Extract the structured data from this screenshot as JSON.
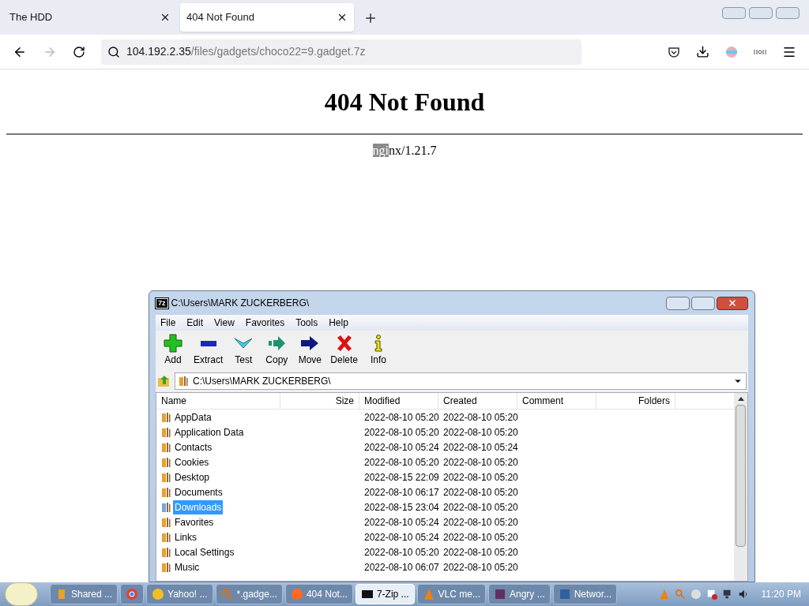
{
  "browser": {
    "tabs": [
      {
        "label": "The HDD",
        "selected": false
      },
      {
        "label": "404 Not Found",
        "selected": true
      }
    ],
    "address": {
      "host": "104.192.2.35",
      "path": "/files/gadgets/choco22=9.gadget.7z"
    }
  },
  "page": {
    "heading": "404 Not Found",
    "footer": [
      {
        "text": "ngi",
        "selected": true
      },
      {
        "text": "nx/1.21.7",
        "selected": false
      }
    ]
  },
  "zip_window": {
    "title": "C:\\Users\\MARK ZUCKERBERG\\",
    "logo": "7z",
    "menu": [
      "File",
      "Edit",
      "View",
      "Favorites",
      "Tools",
      "Help"
    ],
    "toolbar": [
      "Add",
      "Extract",
      "Test",
      "Copy",
      "Move",
      "Delete",
      "Info"
    ],
    "path": "C:\\Users\\MARK ZUCKERBERG\\",
    "columns": [
      "Name",
      "Size",
      "Modified",
      "Created",
      "Comment",
      "Folders"
    ],
    "rows": [
      {
        "name": "AppData",
        "modified": "2022-08-10 05:20",
        "created": "2022-08-10 05:20",
        "selected": false
      },
      {
        "name": "Application Data",
        "modified": "2022-08-10 05:20",
        "created": "2022-08-10 05:20",
        "selected": false
      },
      {
        "name": "Contacts",
        "modified": "2022-08-10 05:24",
        "created": "2022-08-10 05:24",
        "selected": false
      },
      {
        "name": "Cookies",
        "modified": "2022-08-10 05:20",
        "created": "2022-08-10 05:20",
        "selected": false
      },
      {
        "name": "Desktop",
        "modified": "2022-08-15 22:09",
        "created": "2022-08-10 05:20",
        "selected": false
      },
      {
        "name": "Documents",
        "modified": "2022-08-10 06:17",
        "created": "2022-08-10 05:20",
        "selected": false
      },
      {
        "name": "Downloads",
        "modified": "2022-08-15 23:04",
        "created": "2022-08-10 05:20",
        "selected": true
      },
      {
        "name": "Favorites",
        "modified": "2022-08-10 05:24",
        "created": "2022-08-10 05:20",
        "selected": false
      },
      {
        "name": "Links",
        "modified": "2022-08-10 05:24",
        "created": "2022-08-10 05:20",
        "selected": false
      },
      {
        "name": "Local Settings",
        "modified": "2022-08-10 05:20",
        "created": "2022-08-10 05:20",
        "selected": false
      },
      {
        "name": "Music",
        "modified": "2022-08-10 06:07",
        "created": "2022-08-10 05:20",
        "selected": false
      }
    ]
  },
  "taskbar": {
    "buttons": [
      {
        "label": "Shared ...",
        "selected": false
      },
      {
        "selected": false
      },
      {
        "label": "Yahoo! ...",
        "selected": false
      },
      {
        "label": "*.gadge...",
        "selected": false
      },
      {
        "label": "404 Not...",
        "selected": false
      },
      {
        "label": "7-Zip ...",
        "selected": true
      },
      {
        "label": "VLC me...",
        "selected": false
      },
      {
        "label": "Angry ...",
        "selected": false
      },
      {
        "label": "Networ...",
        "selected": false
      }
    ],
    "clock": "11:20 PM"
  }
}
